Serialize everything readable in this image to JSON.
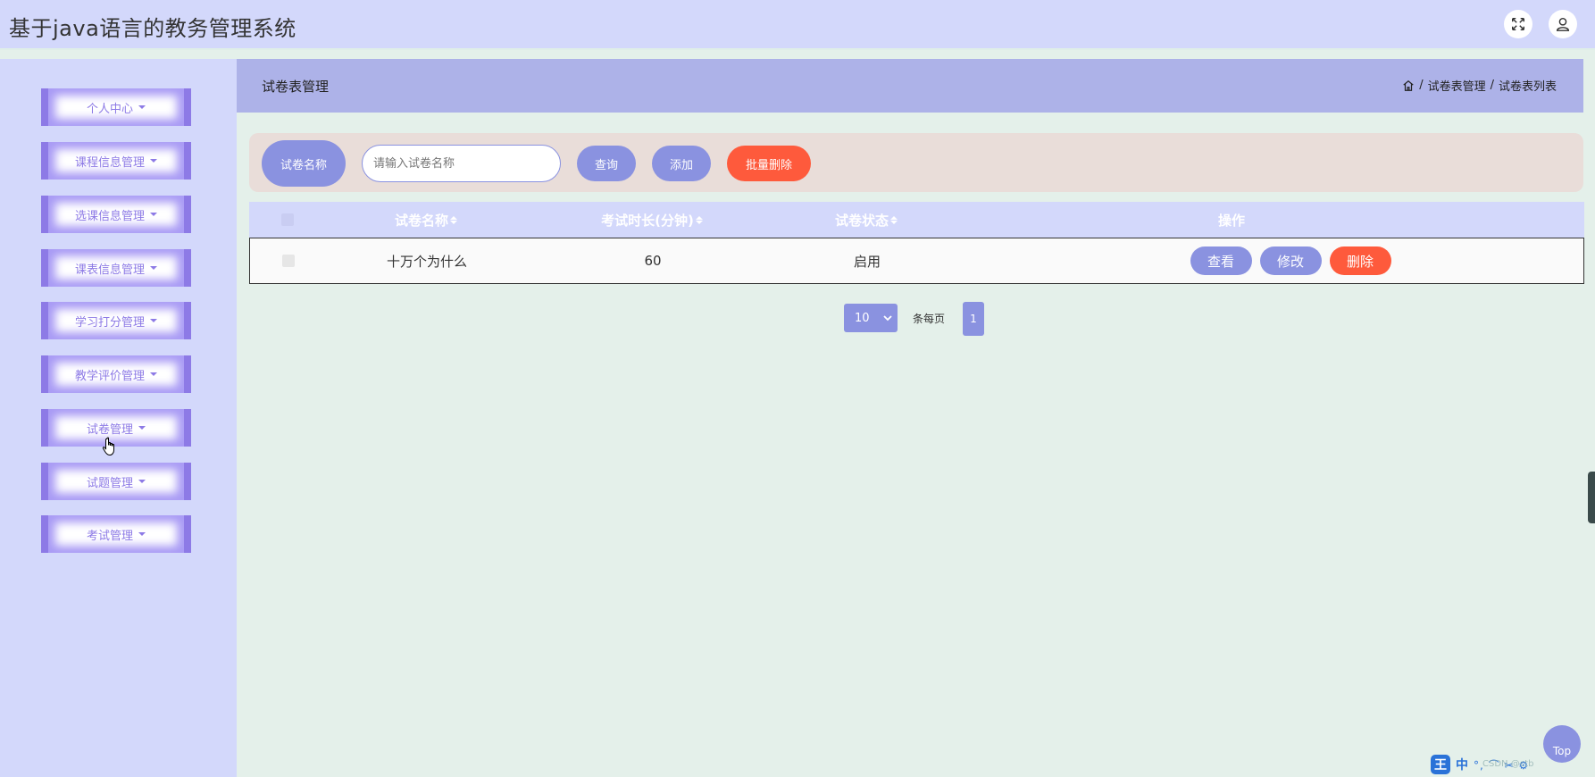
{
  "header": {
    "title": "基于java语言的教务管理系统",
    "fullscreen_icon": "expand-icon",
    "user_icon": "user-icon"
  },
  "sidebar": {
    "items": [
      {
        "label": "个人中心"
      },
      {
        "label": "课程信息管理"
      },
      {
        "label": "选课信息管理"
      },
      {
        "label": "课表信息管理"
      },
      {
        "label": "学习打分管理"
      },
      {
        "label": "教学评价管理"
      },
      {
        "label": "试卷管理"
      },
      {
        "label": "试题管理"
      },
      {
        "label": "考试管理"
      }
    ]
  },
  "page": {
    "title": "试卷表管理",
    "breadcrumb": {
      "home_icon": "home-icon",
      "separator": "/",
      "level1": "试卷表管理",
      "level2": "试卷表列表"
    }
  },
  "search": {
    "label": "试卷名称",
    "placeholder": "请输入试卷名称",
    "value": "",
    "query_button": "查询",
    "add_button": "添加",
    "batch_delete_button": "批量删除"
  },
  "table": {
    "columns": [
      "试卷名称",
      "考试时长(分钟)",
      "试卷状态",
      "操作"
    ],
    "rows": [
      {
        "name": "十万个为什么",
        "duration": "60",
        "status": "启用",
        "actions": {
          "view": "查看",
          "edit": "修改",
          "delete": "删除"
        }
      }
    ]
  },
  "pagination": {
    "page_size": "10",
    "per_page_label": "条每页",
    "current_page": "1"
  },
  "back_to_top": "Top",
  "ime": {
    "logo": "王",
    "mode": "中",
    "tray": "°, ⌒ ✂ ⚙",
    "watermark": "CSDN @ctb"
  },
  "colors": {
    "accent": "#8a92e0",
    "danger": "#fe5a3c",
    "sidebar_bg": "#d3d8fb",
    "menu_purple": "#8d7ae6",
    "page_header_bg": "#adb2e8"
  }
}
